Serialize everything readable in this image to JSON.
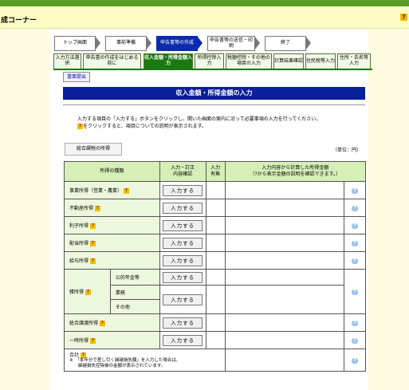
{
  "header": {
    "title": "成コーナー",
    "help_label": "?"
  },
  "steps": [
    {
      "label": "トップ画面"
    },
    {
      "label": "事前準備"
    },
    {
      "label": "申告書等の作成"
    },
    {
      "label": "申告書等の送信・印刷"
    },
    {
      "label": "終了"
    }
  ],
  "substeps": [
    {
      "label": "入力方法選択"
    },
    {
      "label": "申告書の作成をはじめる前に"
    },
    {
      "label": "収入金額・所得金額入力"
    },
    {
      "label": "所得控除入力"
    },
    {
      "label": "税額控除・その他の項目の入力"
    },
    {
      "label": "計算結果確認"
    },
    {
      "label": "住民税等入力"
    },
    {
      "label": "住所・氏名等入力"
    }
  ],
  "print_button": "書面提出",
  "page_title": "収入金額・所得金額の入力",
  "instructions": {
    "line1": "入力する項目の「入力する」ボタンをクリックし、開いた画面の案内に沿って必要事項の入力を行ってください。",
    "line2": "をクリックすると、項目についての説明が表示されます。"
  },
  "tab_label": "総合課税の所得",
  "unit_label": "（単位：円）",
  "table": {
    "headers": {
      "type": "所得の種類",
      "input": "入力・訂正\n内容確認",
      "status": "入力\n有無",
      "amount": "入力内容から計算した所得金額\n（?から表示金額の説明を確認できます。）"
    },
    "input_button_label": "入力する",
    "rows": [
      {
        "label": "事業所得（営業・農業）"
      },
      {
        "label": "不動産所得"
      },
      {
        "label": "利子所得"
      },
      {
        "label": "配当所得"
      },
      {
        "label": "給与所得"
      },
      {
        "label": "雑所得",
        "sub": [
          {
            "label": "公的年金等"
          },
          {
            "label": "業務"
          },
          {
            "label": "その他"
          }
        ]
      },
      {
        "label": "総合譲渡所得"
      },
      {
        "label": "一時所得"
      },
      {
        "label": "合計"
      }
    ],
    "total_note": "※　「本年分で差し引く繰越損失額」を入力した場合は、\n　　繰越損失控除後の金額が表示されています。"
  },
  "colors": {
    "accent_blue": "#0a1f9a",
    "accent_green": "#1a7a10",
    "header_green": "#d6efb6"
  }
}
